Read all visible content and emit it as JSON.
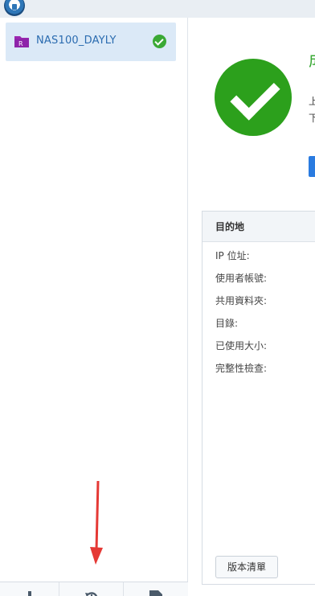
{
  "sidebar": {
    "task": {
      "name": "NAS100_DAYLY",
      "folder_badge": "R",
      "status_icon": "success-check-icon"
    }
  },
  "toolbar": {
    "buttons": [
      {
        "name": "add",
        "icon": "plus-icon"
      },
      {
        "name": "history",
        "icon": "history-icon"
      },
      {
        "name": "log",
        "icon": "document-icon"
      }
    ]
  },
  "main": {
    "status_title": "成",
    "status_line1": "上",
    "status_line2": "下",
    "destination": {
      "header": "目的地",
      "rows": [
        "IP 位址:",
        "使用者帳號:",
        "共用資料夾:",
        "目錄:",
        "已使用大小:",
        "完整性檢查:"
      ],
      "version_button": "版本清單"
    }
  },
  "colors": {
    "success_green": "#2ca01c",
    "selected_row_bg": "#dbe9f7",
    "accent_blue": "#2a7be0",
    "annotation_red": "#e53935"
  }
}
